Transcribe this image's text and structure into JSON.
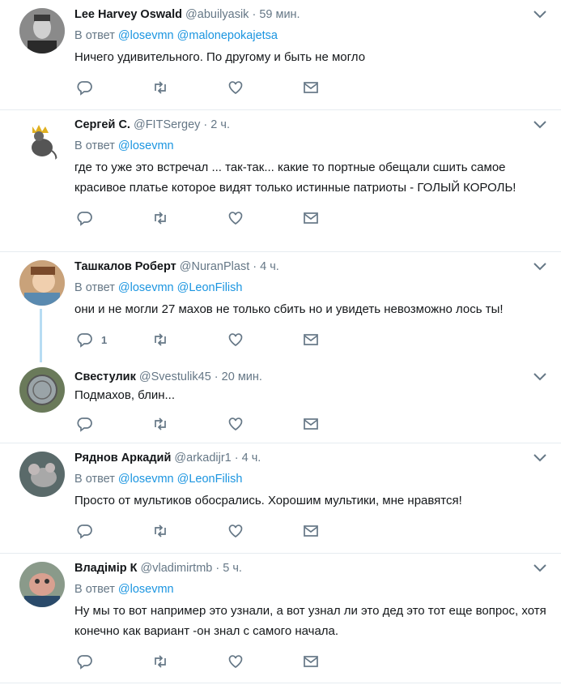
{
  "reply_prefix": "В ответ",
  "tweets": [
    {
      "name": "Lee Harvey Oswald",
      "handle": "@abuilyasik",
      "dot": "·",
      "time": "59 мин.",
      "mentions": [
        "@losevmn",
        "@malonepokajetsa"
      ],
      "text": "Ничего удивительного. По другому и быть не могло",
      "reply_count": ""
    },
    {
      "name": "Сергей С.",
      "handle": "@FITSergey",
      "dot": "·",
      "time": "2 ч.",
      "mentions": [
        "@losevmn"
      ],
      "text": "где то уже это встречал ... так-так... какие то портные обещали сшить  самое красивое платье которое видят только истинные патриоты - ГОЛЫЙ КОРОЛЬ!",
      "reply_count": ""
    },
    {
      "name": "Ташкалов Роберт",
      "handle": "@NuranPlast",
      "dot": "·",
      "time": "4 ч.",
      "mentions": [
        "@losevmn",
        "@LeonFilish"
      ],
      "text": "они и не могли 27 махов не только сбить но и увидеть невозможно лось ты!",
      "reply_count": "1"
    },
    {
      "name": "Свестулик",
      "handle": "@Svestulik45",
      "dot": "·",
      "time": "20 мин.",
      "mentions": [],
      "text": "Подмахов, блин...",
      "reply_count": ""
    },
    {
      "name": "Ряднов Аркадий",
      "handle": "@arkadijr1",
      "dot": "·",
      "time": "4 ч.",
      "mentions": [
        "@losevmn",
        "@LeonFilish"
      ],
      "text": "Просто от мультиков обосрались. Хорошим мультики, мне нравятся!",
      "reply_count": ""
    },
    {
      "name": "Владімір К",
      "handle": "@vladimirtmb",
      "dot": "·",
      "time": "5 ч.",
      "mentions": [
        "@losevmn"
      ],
      "text": "Ну мы то вот например это узнали, а вот узнал ли это дед это тот еще вопрос, хотя конечно как вариант -он знал с самого начала.",
      "reply_count": ""
    }
  ],
  "colors": {
    "accent": "#1b95e0",
    "muted": "#657786",
    "text": "#14171a",
    "divider": "#e6ecf0",
    "thread": "#b7dcf3"
  },
  "icons": [
    "chevron-down-icon",
    "reply-icon",
    "retweet-icon",
    "like-icon",
    "dm-icon"
  ]
}
